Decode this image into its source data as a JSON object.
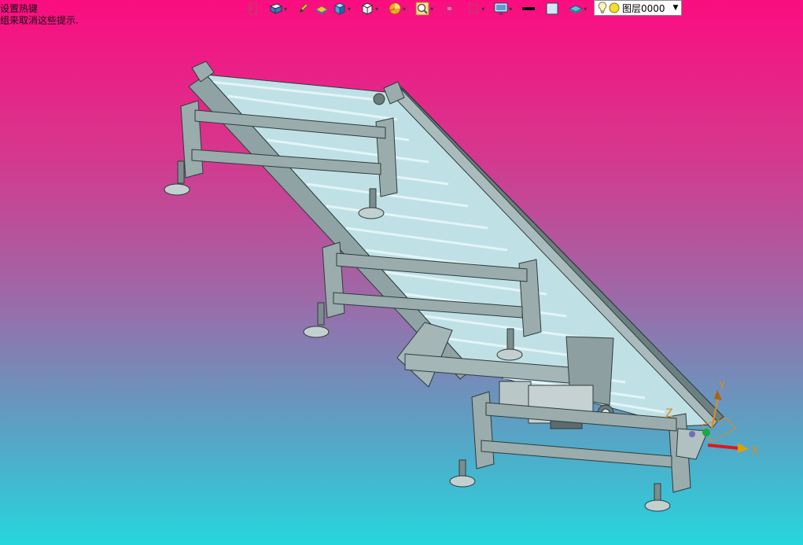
{
  "hint": {
    "line1": "设置热键",
    "line2": "组来取消这些提示."
  },
  "toolbar": {
    "icons": [
      {
        "name": "exit-sketch-icon"
      },
      {
        "name": "view-mode-icon",
        "dropdown": true
      },
      {
        "name": "pencil-icon"
      },
      {
        "name": "material-icon"
      },
      {
        "name": "shaded-cube-icon",
        "dropdown": true
      },
      {
        "name": "wire-cube-icon",
        "dropdown": true
      },
      {
        "name": "section-icon",
        "dropdown": true
      },
      {
        "name": "zoom-icon",
        "dropdown": true
      },
      {
        "name": "rotate-view-icon"
      },
      {
        "name": "measure-icon",
        "dropdown": true
      },
      {
        "name": "display-icon",
        "dropdown": true
      },
      {
        "name": "line-color-icon"
      },
      {
        "name": "face-color-icon"
      },
      {
        "name": "render-icon",
        "dropdown": true
      }
    ]
  },
  "layer": {
    "label": "图层0000"
  },
  "triad": {
    "x_label": "X",
    "y_label": "Y",
    "z_label": "Z"
  },
  "colors": {
    "frame": "#9aacac",
    "frame_dark": "#59696a",
    "roller": "#c7e6ea",
    "axis_x": "#e01818",
    "axis_y": "#19a84a",
    "axis_label": "#e28a1a"
  }
}
